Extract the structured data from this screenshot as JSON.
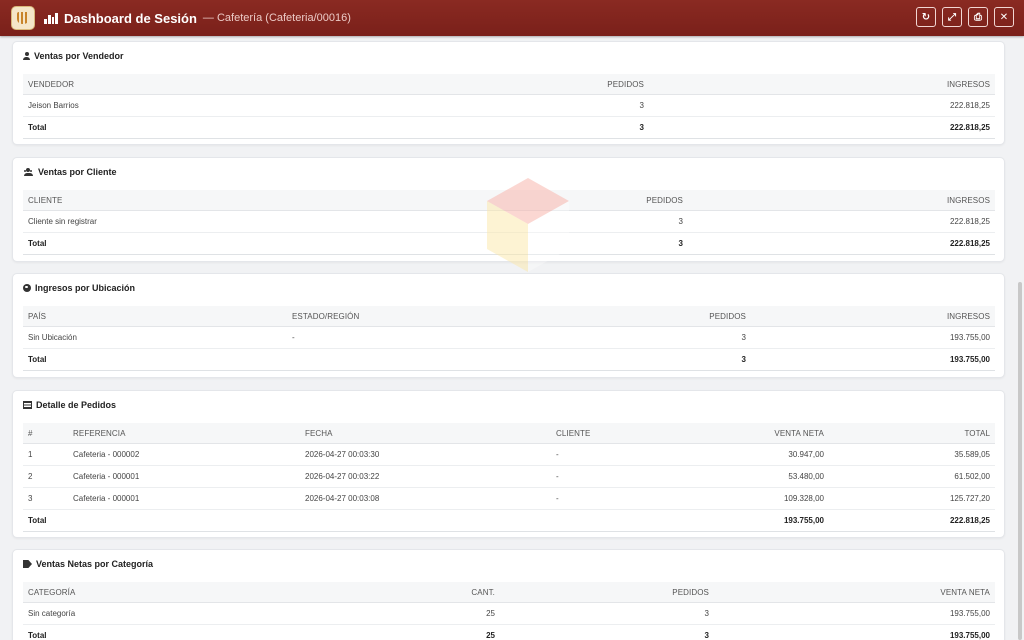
{
  "window": {
    "title": "Dashboard de Sesión",
    "subtitle": "— Cafetería (Cafeteria/00016)",
    "buttons": {
      "refresh": "↻",
      "fullscreen": "⤢",
      "pdf": "⎙",
      "close": "✕"
    }
  },
  "vendedor": {
    "title": "Ventas por Vendedor",
    "headers": [
      "VENDEDOR",
      "PEDIDOS",
      "INGRESOS"
    ],
    "rows": [
      [
        "Jeison Barrios",
        "3",
        "222.818,25"
      ]
    ],
    "total": [
      "Total",
      "3",
      "222.818,25"
    ]
  },
  "cliente": {
    "title": "Ventas por Cliente",
    "headers": [
      "CLIENTE",
      "PEDIDOS",
      "INGRESOS"
    ],
    "rows": [
      [
        "Cliente sin registrar",
        "3",
        "222.818,25"
      ]
    ],
    "total": [
      "Total",
      "3",
      "222.818,25"
    ]
  },
  "ubicacion": {
    "title": "Ingresos por Ubicación",
    "headers": [
      "PAÍS",
      "ESTADO/REGIÓN",
      "PEDIDOS",
      "INGRESOS"
    ],
    "rows": [
      [
        "Sin Ubicación",
        "-",
        "3",
        "193.755,00"
      ]
    ],
    "total": [
      "Total",
      "",
      "3",
      "193.755,00"
    ]
  },
  "pedidos": {
    "title": "Detalle de Pedidos",
    "headers": [
      "#",
      "REFERENCIA",
      "FECHA",
      "CLIENTE",
      "VENTA NETA",
      "TOTAL"
    ],
    "rows": [
      [
        "1",
        "Cafeteria - 000002",
        "2026-04-27 00:03:30",
        "-",
        "30.947,00",
        "35.589,05"
      ],
      [
        "2",
        "Cafeteria - 000001",
        "2026-04-27 00:03:22",
        "-",
        "53.480,00",
        "61.502,00"
      ],
      [
        "3",
        "Cafeteria - 000001",
        "2026-04-27 00:03:08",
        "-",
        "109.328,00",
        "125.727,20"
      ]
    ],
    "total": [
      "Total",
      "",
      "",
      "",
      "193.755,00",
      "222.818,25"
    ]
  },
  "categoria": {
    "title": "Ventas Netas por Categoría",
    "headers": [
      "CATEGORÍA",
      "CANT.",
      "PEDIDOS",
      "VENTA NETA"
    ],
    "rows": [
      [
        "Sin categoría",
        "25",
        "3",
        "193.755,00"
      ]
    ],
    "total": [
      "Total",
      "25",
      "3",
      "193.755,00"
    ]
  }
}
